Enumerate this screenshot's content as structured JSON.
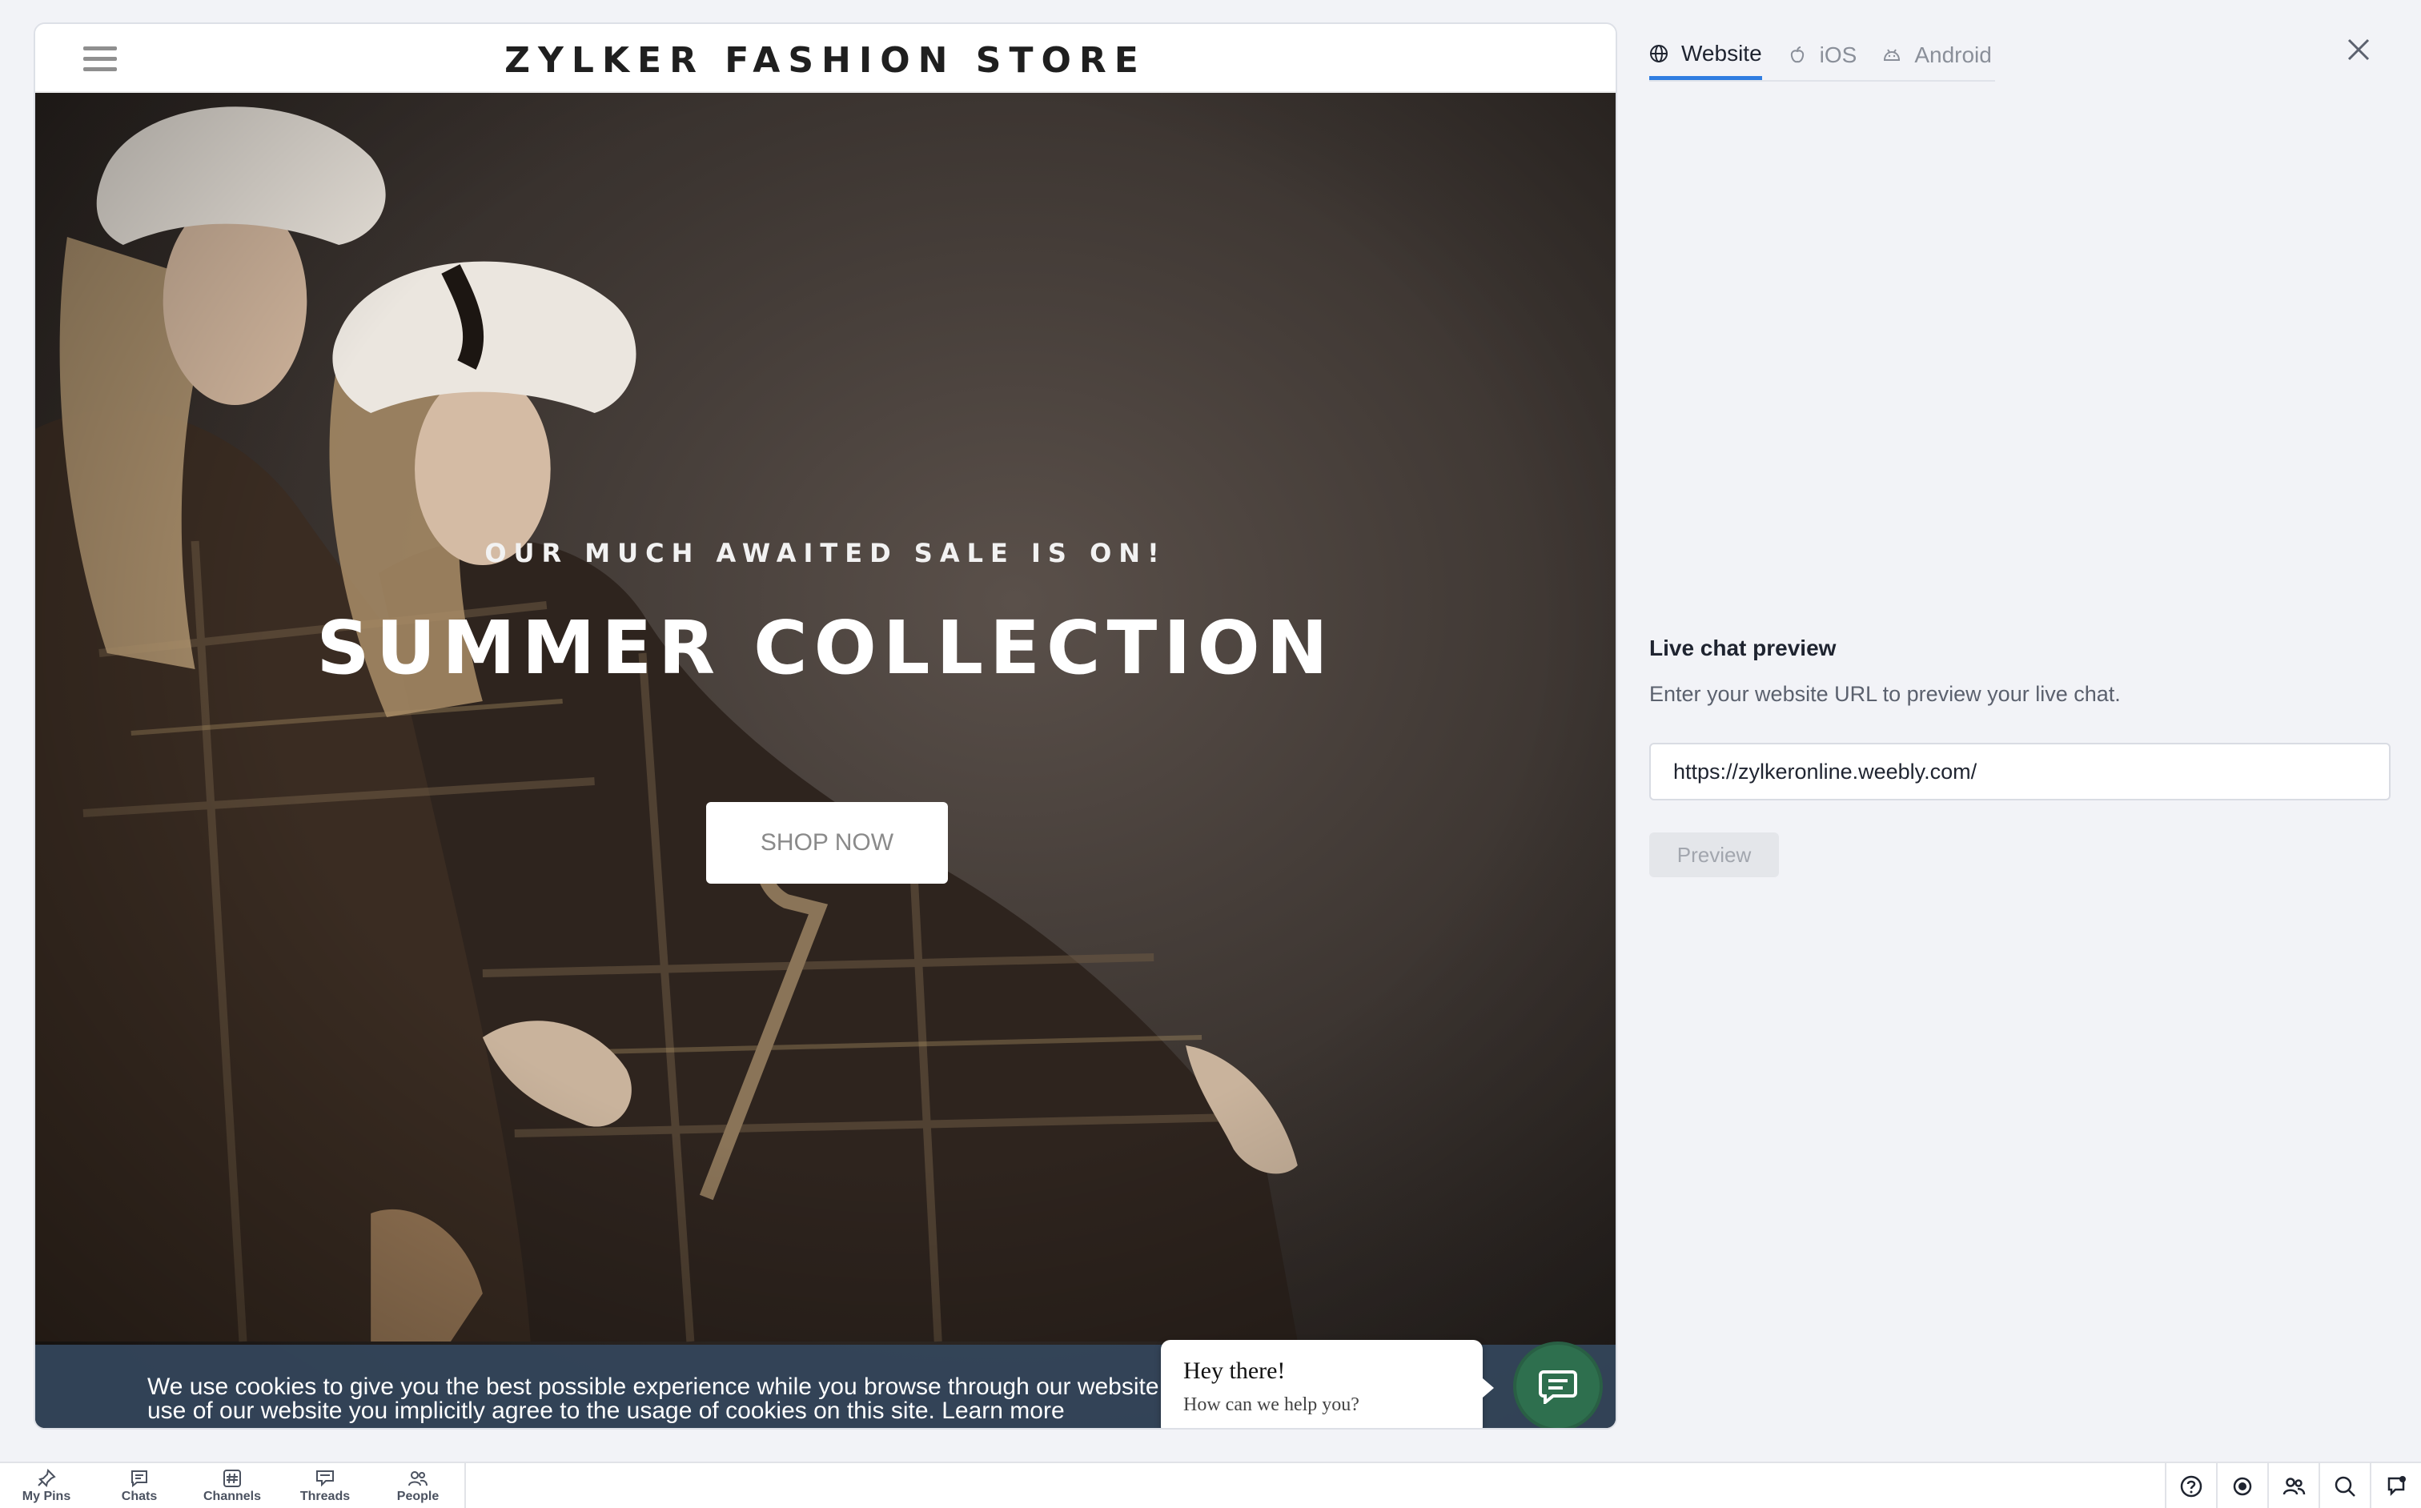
{
  "site": {
    "store_title": "ZYLKER FASHION STORE",
    "hero_kicker": "OUR MUCH AWAITED SALE IS ON!",
    "hero_title": "SUMMER COLLECTION",
    "shop_button": "SHOP NOW",
    "cookie_line1": "We use cookies to give you the best possible experience while you browse through our website.",
    "cookie_line2": "use of our website you implicitly agree to the usage of cookies on this site.",
    "cookie_learn_more": "Learn more"
  },
  "chat_widget": {
    "greeting": "Hey there!",
    "prompt": "How can we help you?",
    "accent_color": "#2e6f4e"
  },
  "panel": {
    "tabs": [
      {
        "label": "Website",
        "icon": "globe-icon",
        "active": true
      },
      {
        "label": "iOS",
        "icon": "apple-icon",
        "active": false
      },
      {
        "label": "Android",
        "icon": "android-icon",
        "active": false
      }
    ],
    "heading": "Live chat preview",
    "description": "Enter your website URL to preview your live chat.",
    "url_value": "https://zylkeronline.weebly.com/",
    "preview_button": "Preview",
    "accent_color": "#2f7de1"
  },
  "bottom_nav": {
    "items": [
      {
        "label": "My Pins",
        "icon": "pin-icon"
      },
      {
        "label": "Chats",
        "icon": "chat-icon"
      },
      {
        "label": "Channels",
        "icon": "hash-icon"
      },
      {
        "label": "Threads",
        "icon": "threads-icon"
      },
      {
        "label": "People",
        "icon": "people-icon"
      }
    ],
    "right_icons": [
      "help-icon",
      "status-icon",
      "contacts-icon",
      "search-icon",
      "notifications-icon"
    ]
  }
}
